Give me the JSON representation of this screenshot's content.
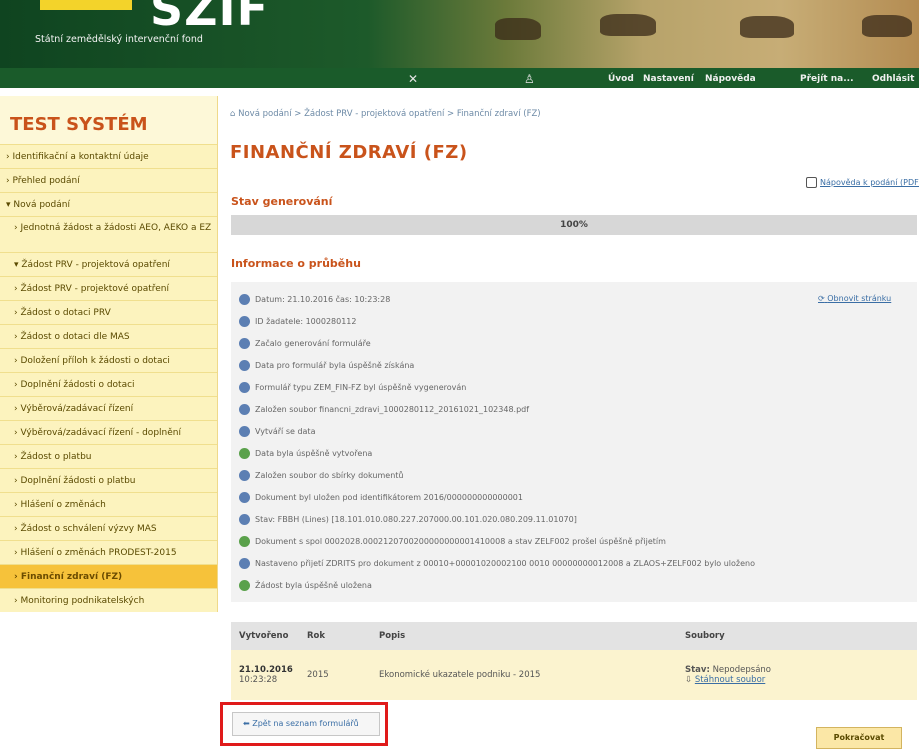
{
  "header": {
    "logo": "SZIF",
    "subtitle": "Státní zemědělský intervenční fond",
    "nav": [
      "Úvod",
      "Nastavení",
      "Nápověda",
      "Přejít na...",
      "Odhlásit"
    ]
  },
  "sidebar": {
    "title": "TEST SYSTÉM",
    "items": [
      {
        "label": "Identifikační a kontaktní údaje",
        "sub": false
      },
      {
        "label": "Přehled podání",
        "sub": false
      },
      {
        "label": "Nová podání",
        "sub": false
      },
      {
        "label": "Jednotná žádost a žádosti AEO, AEKO a EZ",
        "sub": true
      },
      {
        "label": "Žádost PRV - projektová opatření",
        "sub": true
      },
      {
        "label": "Žádost PRV - projektové opatření",
        "sub": true
      },
      {
        "label": "Žádost o dotaci PRV",
        "sub": true
      },
      {
        "label": "Žádost o dotaci dle MAS",
        "sub": true
      },
      {
        "label": "Doložení příloh k žádosti o dotaci",
        "sub": true
      },
      {
        "label": "Doplnění žádosti o dotaci",
        "sub": true
      },
      {
        "label": "Výběrová/zadávací řízení",
        "sub": true
      },
      {
        "label": "Výběrová/zadávací řízení - doplnění",
        "sub": true
      },
      {
        "label": "Žádost o platbu",
        "sub": true
      },
      {
        "label": "Doplnění žádosti o platbu",
        "sub": true
      },
      {
        "label": "Hlášení o změnách",
        "sub": true
      },
      {
        "label": "Žádost o schválení výzvy MAS",
        "sub": true
      },
      {
        "label": "Hlášení o změnách PRODEST-2015",
        "sub": true
      },
      {
        "label": "Finanční zdraví (FZ)",
        "sub": true,
        "active": true
      },
      {
        "label": "Monitoring podnikatelských",
        "sub": true
      }
    ]
  },
  "breadcrumb": "Nová podání > Žádost PRV - projektová opatření > Finanční zdraví (FZ)",
  "page_title": "FINANČNÍ ZDRAVÍ (FZ)",
  "help_link": "Nápověda k podání (PDF)",
  "generation": {
    "heading": "Stav generování",
    "progress_text": "100%",
    "progress_value": 100
  },
  "info": {
    "heading": "Informace o průběhu",
    "status_link": "Obnovit stránku",
    "rows": [
      {
        "status": "info",
        "text": "Datum: 21.10.2016 čas: 10:23:28"
      },
      {
        "status": "info",
        "text": "ID žadatele: 1000280112"
      },
      {
        "status": "info",
        "text": "Začalo generování formuláře"
      },
      {
        "status": "info",
        "text": "Data pro formulář byla úspěšně získána"
      },
      {
        "status": "info",
        "text": "Formulář typu ZEM_FIN-FZ byl úspěšně vygenerován"
      },
      {
        "status": "info",
        "text": "Založen soubor financni_zdravi_1000280112_20161021_102348.pdf"
      },
      {
        "status": "info",
        "text": "Vytváří se data"
      },
      {
        "status": "success",
        "text": "Data byla úspěšně vytvořena"
      },
      {
        "status": "info",
        "text": "Založen soubor do sbírky dokumentů"
      },
      {
        "status": "info",
        "text": "Dokument byl uložen pod identifikátorem 2016/000000000000001"
      },
      {
        "status": "info",
        "text": "Stav: FBBH (Lines) [18.101.010.080.227.207000.00.101.020.080.209.11.01070]"
      },
      {
        "status": "success",
        "text": "Dokument s spol 0002028.0002120700200000000001410008 a stav ZELF002 prošel úspěšně přijetím"
      },
      {
        "status": "info",
        "text": "Nastaveno přijetí ZDRITS pro dokument z 00010+00001020002100 0010 00000000012008 a ZLAOS+ZELF002 bylo uloženo"
      },
      {
        "status": "success",
        "text": "Žádost byla úspěšně uložena"
      }
    ]
  },
  "table": {
    "headers": [
      "Vytvořeno",
      "Rok",
      "Popis",
      "Soubory"
    ],
    "rows": [
      {
        "date": "21.10.2016",
        "time": "10:23:28",
        "year": "2015",
        "description": "Ekonomické ukazatele podniku - 2015",
        "status_label": "Stav:",
        "status_value": "Nepodepsáno",
        "file_link": "Stáhnout soubor"
      }
    ]
  },
  "buttons": {
    "back": "Zpět na seznam formulářů",
    "continue": "Pokračovat"
  }
}
